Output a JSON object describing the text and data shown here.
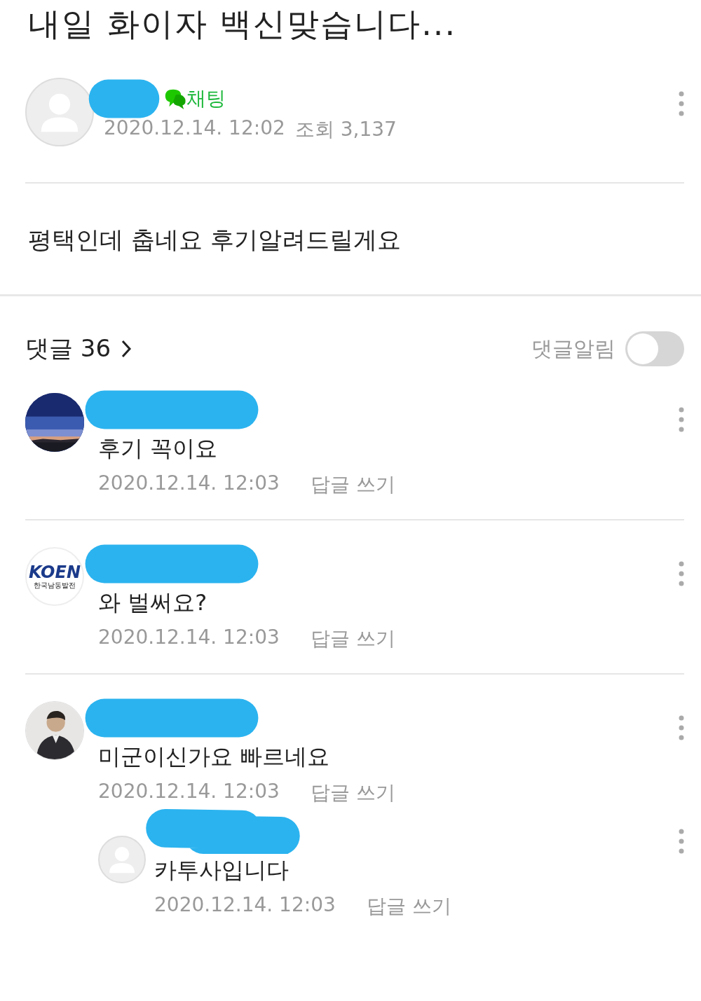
{
  "post": {
    "title": "내일 화이자 백신맞습니다...",
    "author": {
      "avatar": {
        "kind": "default"
      },
      "name_redacted": true,
      "chat_label": "채팅"
    },
    "date": "2020.12.14. 12:02",
    "views": "조회 3,137",
    "body": "평택인데 춥네요 후기알려드릴게요"
  },
  "comments_header": {
    "label": "댓글 36",
    "notify_label": "댓글알림",
    "notify_on": false
  },
  "comments": [
    {
      "name_redacted": true,
      "text": "후기 꼭이요",
      "date": "2020.12.14. 12:03",
      "reply_label": "답글 쓰기"
    },
    {
      "avatar": {
        "kind": "logo",
        "logo_text": [
          "KOEN",
          "한국남동발전"
        ]
      },
      "name_redacted": true,
      "text": "와 벌써요?",
      "date": "2020.12.14. 12:03",
      "reply_label": "답글 쓰기"
    },
    {
      "avatar": {
        "kind": "person"
      },
      "name_redacted": true,
      "text": "미군이신가요 빠르네요",
      "date": "2020.12.14. 12:03",
      "reply_label": "답글 쓰기",
      "children": [
        {
          "avatar": {
            "kind": "default"
          },
          "name_redacted": true,
          "text": "카투사입니다",
          "date": "2020.12.14. 12:03",
          "reply_label": "답글 쓰기"
        }
      ]
    }
  ]
}
